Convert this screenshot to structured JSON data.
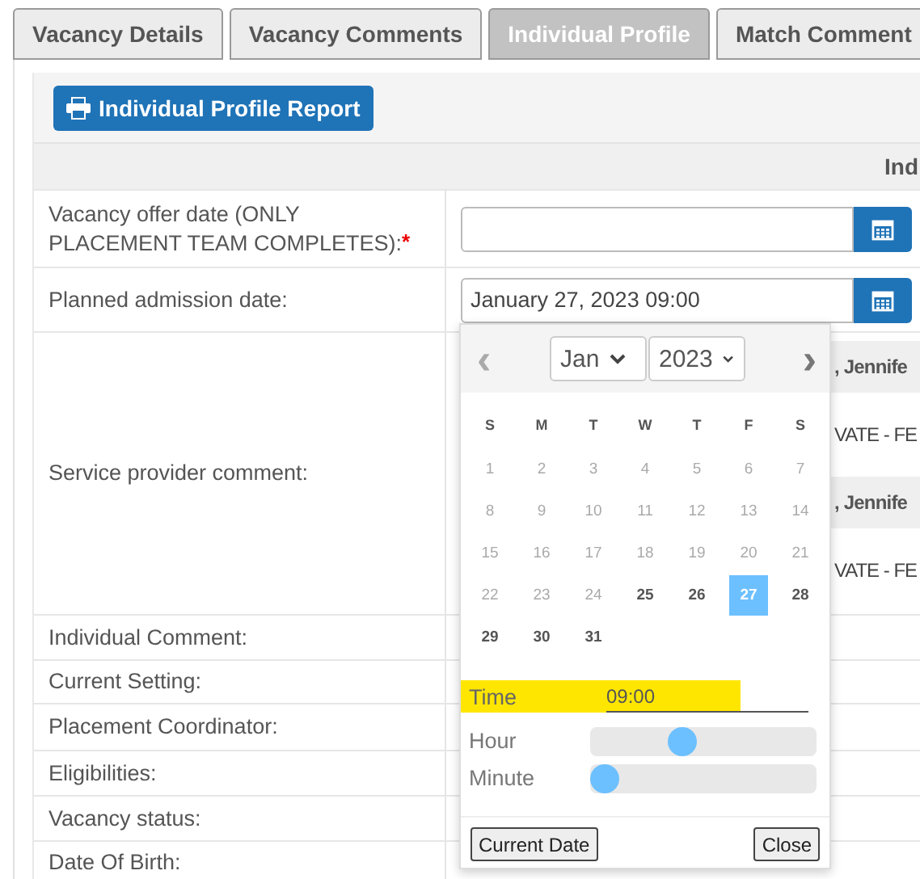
{
  "tabs": [
    {
      "label": "Vacancy Details",
      "selected": false
    },
    {
      "label": "Vacancy Comments",
      "selected": false
    },
    {
      "label": "Individual Profile",
      "selected": true
    },
    {
      "label": "Match Comment",
      "selected": false
    }
  ],
  "report_button": {
    "label": "Individual Profile Report"
  },
  "table": {
    "header": "Ind",
    "required_mark": "*",
    "rows": [
      {
        "label": "Vacancy offer date (ONLY PLACEMENT TEAM COMPLETES):",
        "required": true,
        "kind": "date",
        "value": ""
      },
      {
        "label": "Planned admission date:",
        "required": false,
        "kind": "date",
        "value": "January 27, 2023 09:00"
      },
      {
        "label": "Service provider comment:",
        "required": false,
        "kind": "comments",
        "comments": [
          {
            "author": ", Jennife",
            "text": "VATE - FE"
          },
          {
            "author": ", Jennife",
            "text": "VATE - FE"
          }
        ]
      },
      {
        "label": "Individual Comment:",
        "required": false,
        "kind": "plain"
      },
      {
        "label": "Current Setting:",
        "required": false,
        "kind": "plain"
      },
      {
        "label": "Placement Coordinator:",
        "required": false,
        "kind": "plain"
      },
      {
        "label": "Eligibilities:",
        "required": false,
        "kind": "plain"
      },
      {
        "label": "Vacancy status:",
        "required": false,
        "kind": "plain"
      },
      {
        "label": "Date Of Birth:",
        "required": false,
        "kind": "plain"
      }
    ]
  },
  "datepicker": {
    "prev": "‹",
    "next": "›",
    "month": "Jan",
    "year": "2023",
    "weekdays": [
      "S",
      "M",
      "T",
      "W",
      "T",
      "F",
      "S"
    ],
    "weeks": [
      [
        {
          "day": "1",
          "disabled": true,
          "selected": false
        },
        {
          "day": "2",
          "disabled": true,
          "selected": false
        },
        {
          "day": "3",
          "disabled": true,
          "selected": false
        },
        {
          "day": "4",
          "disabled": true,
          "selected": false
        },
        {
          "day": "5",
          "disabled": true,
          "selected": false
        },
        {
          "day": "6",
          "disabled": true,
          "selected": false
        },
        {
          "day": "7",
          "disabled": true,
          "selected": false
        }
      ],
      [
        {
          "day": "8",
          "disabled": true,
          "selected": false
        },
        {
          "day": "9",
          "disabled": true,
          "selected": false
        },
        {
          "day": "10",
          "disabled": true,
          "selected": false
        },
        {
          "day": "11",
          "disabled": true,
          "selected": false
        },
        {
          "day": "12",
          "disabled": true,
          "selected": false
        },
        {
          "day": "13",
          "disabled": true,
          "selected": false
        },
        {
          "day": "14",
          "disabled": true,
          "selected": false
        }
      ],
      [
        {
          "day": "15",
          "disabled": true,
          "selected": false
        },
        {
          "day": "16",
          "disabled": true,
          "selected": false
        },
        {
          "day": "17",
          "disabled": true,
          "selected": false
        },
        {
          "day": "18",
          "disabled": true,
          "selected": false
        },
        {
          "day": "19",
          "disabled": true,
          "selected": false
        },
        {
          "day": "20",
          "disabled": true,
          "selected": false
        },
        {
          "day": "21",
          "disabled": true,
          "selected": false
        }
      ],
      [
        {
          "day": "22",
          "disabled": true,
          "selected": false
        },
        {
          "day": "23",
          "disabled": true,
          "selected": false
        },
        {
          "day": "24",
          "disabled": true,
          "selected": false
        },
        {
          "day": "25",
          "disabled": false,
          "selected": false
        },
        {
          "day": "26",
          "disabled": false,
          "selected": false
        },
        {
          "day": "27",
          "disabled": false,
          "selected": true
        },
        {
          "day": "28",
          "disabled": false,
          "selected": false
        }
      ],
      [
        {
          "day": "29",
          "disabled": false,
          "selected": false
        },
        {
          "day": "30",
          "disabled": false,
          "selected": false
        },
        {
          "day": "31",
          "disabled": false,
          "selected": false
        }
      ]
    ],
    "time_label": "Time",
    "time_value": "09:00",
    "sliders": [
      {
        "label": "Hour",
        "level": 0.39
      },
      {
        "label": "Minute",
        "level": 0
      }
    ],
    "current_button": "Current Date",
    "close_button": "Close"
  }
}
